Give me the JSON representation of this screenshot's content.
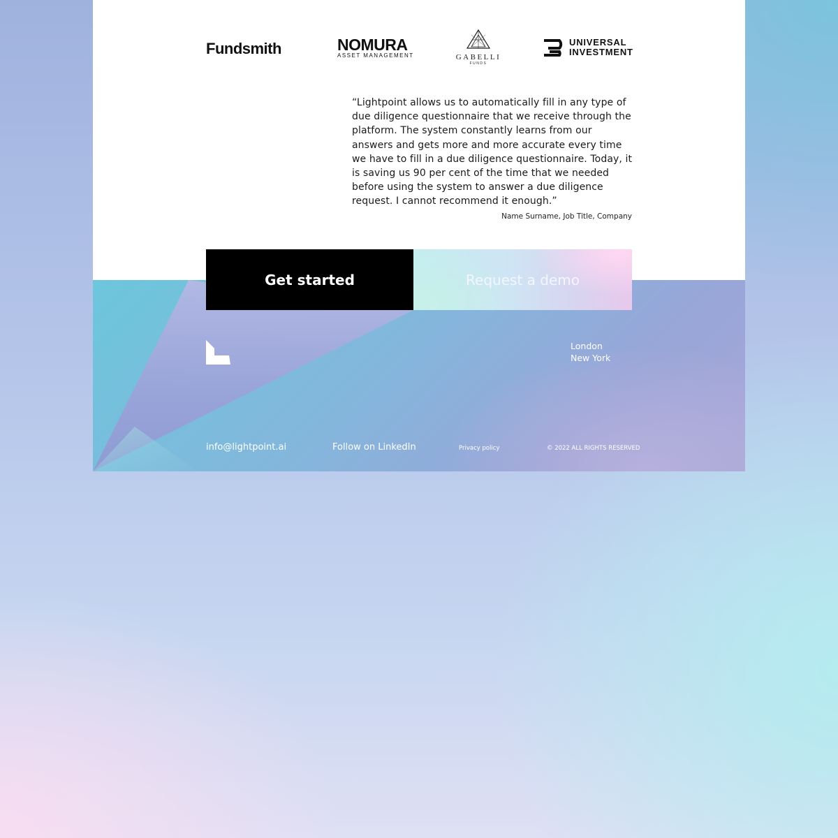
{
  "logos": {
    "fundsmith": "Fundsmith",
    "nomura": {
      "main": "NOMURA",
      "sub": "ASSET MANAGEMENT"
    },
    "gabelli": {
      "main": "GABELLI",
      "sub": "FUNDS"
    },
    "universal": {
      "line1": "UNIVERSAL",
      "line2": "INVESTMENT"
    }
  },
  "testimonial": {
    "quote": "“Lightpoint allows us to automatically fill in any type of due diligence questionnaire that we receive through the platform. The system constantly learns from our answers and gets more and more accurate every time we have to fill in a due diligence questionnaire. Today, it is saving us 90 per cent of the time that we needed before using the system to answer a due diligence request. I cannot recommend it enough.”",
    "attribution": "Name Surname, Job Title, Company"
  },
  "cta": {
    "get_started": "Get started",
    "request_demo": "Request a demo"
  },
  "footer": {
    "cities": [
      "London",
      "New York"
    ],
    "email": "info@lightpoint.ai",
    "linkedin": "Follow on LinkedIn",
    "privacy": "Privacy policy",
    "copyright": "© 2022 ALL RIGHTS RESERVED"
  },
  "icons": {
    "brand": "lightpoint-logo-icon",
    "gabelli": "gabelli-pyramid-icon",
    "universal": "universal-investment-mark-icon"
  },
  "colors": {
    "primary_button": "#000000",
    "card_background": "#ffffff",
    "footer_text": "#ffffff"
  }
}
